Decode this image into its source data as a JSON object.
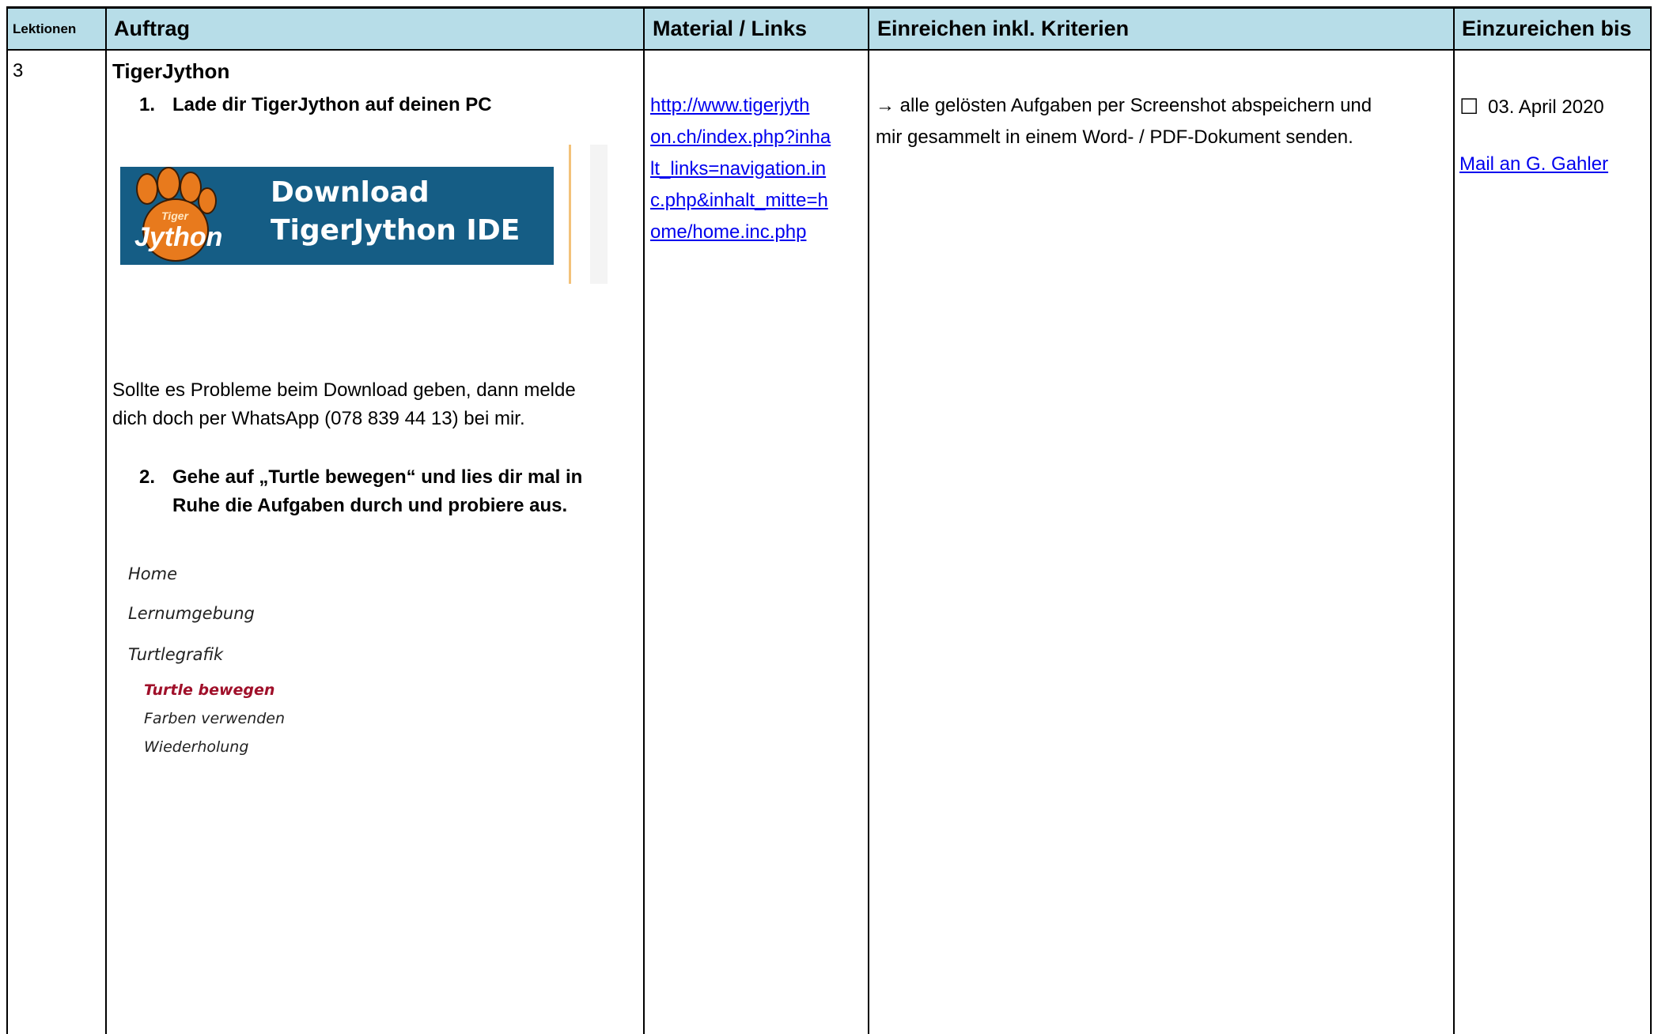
{
  "header": {
    "col_lektionen": "Lektionen",
    "col_auftrag": "Auftrag",
    "col_material": "Material / Links",
    "col_einreichen": "Einreichen inkl. Kriterien",
    "col_bis": "Einzureichen bis"
  },
  "row": {
    "lektionen": "3",
    "title": "TigerJython",
    "step1_num": "1.",
    "step1_text": "Lade dir TigerJython auf deinen PC",
    "banner": {
      "logo_text": "Jython",
      "logo_small": "Tiger",
      "line1": "Download",
      "line2": "TigerJython IDE",
      "bg_color": "#155d85"
    },
    "problem_line1": "Sollte es Probleme beim Download geben, dann melde",
    "problem_line2": "dich doch per WhatsApp (078 839 44 13) bei mir.",
    "step2_num": "2.",
    "step2_line1": "Gehe auf „Turtle bewegen“ und lies dir mal in",
    "step2_line2": "Ruhe die Aufgaben durch und probiere aus.",
    "nav": {
      "home": "Home",
      "lernumgebung": "Lernumgebung",
      "turtlegrafik": "Turtlegrafik",
      "sub1": "Turtle bewegen",
      "sub2": "Farben verwenden",
      "sub3": "Wiederholung",
      "active_color": "#a0102a"
    },
    "link_lines": [
      "http://www.tigerjyth",
      "on.ch/index.php?inha",
      "lt_links=navigation.in",
      "c.php&inhalt_mitte=h",
      "ome/home.inc.php"
    ],
    "criteria_line1": "→ alle gelösten Aufgaben per Screenshot abspeichern und",
    "criteria_line2": "mir gesammelt in einem Word- / PDF-Dokument senden.",
    "checkbox": "☐",
    "due_date": "03. April 2020",
    "mail_link": "Mail an G. Gahler"
  },
  "colors": {
    "header_bg": "#b7dde8",
    "link": "#0000ee"
  }
}
